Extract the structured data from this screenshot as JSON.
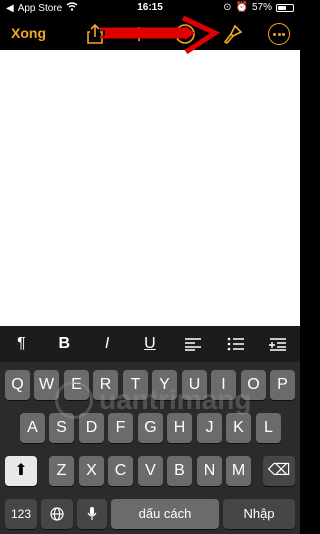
{
  "status": {
    "carrier": "App Store",
    "time": "16:15",
    "battery": "57%"
  },
  "nav": {
    "done_label": "Xong"
  },
  "keyboard": {
    "row1": [
      "Q",
      "W",
      "E",
      "R",
      "T",
      "Y",
      "U",
      "I",
      "O",
      "P"
    ],
    "row2": [
      "A",
      "S",
      "D",
      "F",
      "G",
      "H",
      "J",
      "K",
      "L"
    ],
    "row3": [
      "Z",
      "X",
      "C",
      "V",
      "B",
      "N",
      "M"
    ],
    "numbers_key": "123",
    "space_key": "dấu cách",
    "return_key": "Nhập"
  },
  "toolbar": {
    "paragraph": "¶",
    "bold": "B",
    "italic": "I",
    "underline": "U"
  },
  "watermark": "uantrimang",
  "colors": {
    "accent": "#f5a623",
    "annotation": "#e00000"
  }
}
